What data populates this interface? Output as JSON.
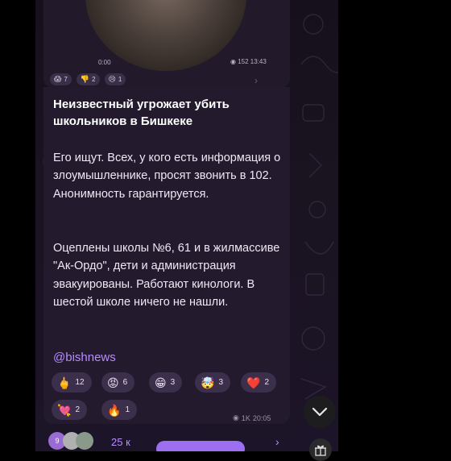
{
  "video": {
    "duration": "0:00",
    "views_time": "152 13:43"
  },
  "top_reactions": [
    {
      "emoji": "😱",
      "count": "7"
    },
    {
      "emoji": "👎",
      "count": "2"
    },
    {
      "emoji": "😢",
      "count": "1"
    }
  ],
  "post": {
    "headline": "Неизвестный угрожает убить школьников в Бишкеке",
    "paragraph1": "Его ищут. Всех, у кого есть информация о злоумышленнике, просят звонить в 102. Анонимность гарантируется.",
    "paragraph2": "Оцеплены школы №6, 61 и в жилмассиве \"Ак-Ордо\", дети и администрация эвакуированы. Работают кинологи. В шестой школе ничего не нашли.",
    "handle": "@bishnews"
  },
  "reactions": [
    {
      "emoji": "🖕",
      "count": "12"
    },
    {
      "emoji": "😡",
      "count": "6"
    },
    {
      "emoji": "😁",
      "count": "3"
    },
    {
      "emoji": "🤯",
      "count": "3"
    },
    {
      "emoji": "❤️",
      "count": "2"
    },
    {
      "emoji": "💘",
      "count": "2"
    },
    {
      "emoji": "🔥",
      "count": "1"
    }
  ],
  "meta": {
    "views": "1K",
    "time": "20:05"
  },
  "comments": {
    "avatar_badge": "9",
    "count_partial": "25 к"
  },
  "colors": {
    "accent": "#b88cff",
    "bubble": "#231b2d",
    "reaction_pill": "#3b2f4b"
  },
  "icons": [
    "eye-icon",
    "chevron-down-icon",
    "chevron-right-icon",
    "gift-icon"
  ]
}
